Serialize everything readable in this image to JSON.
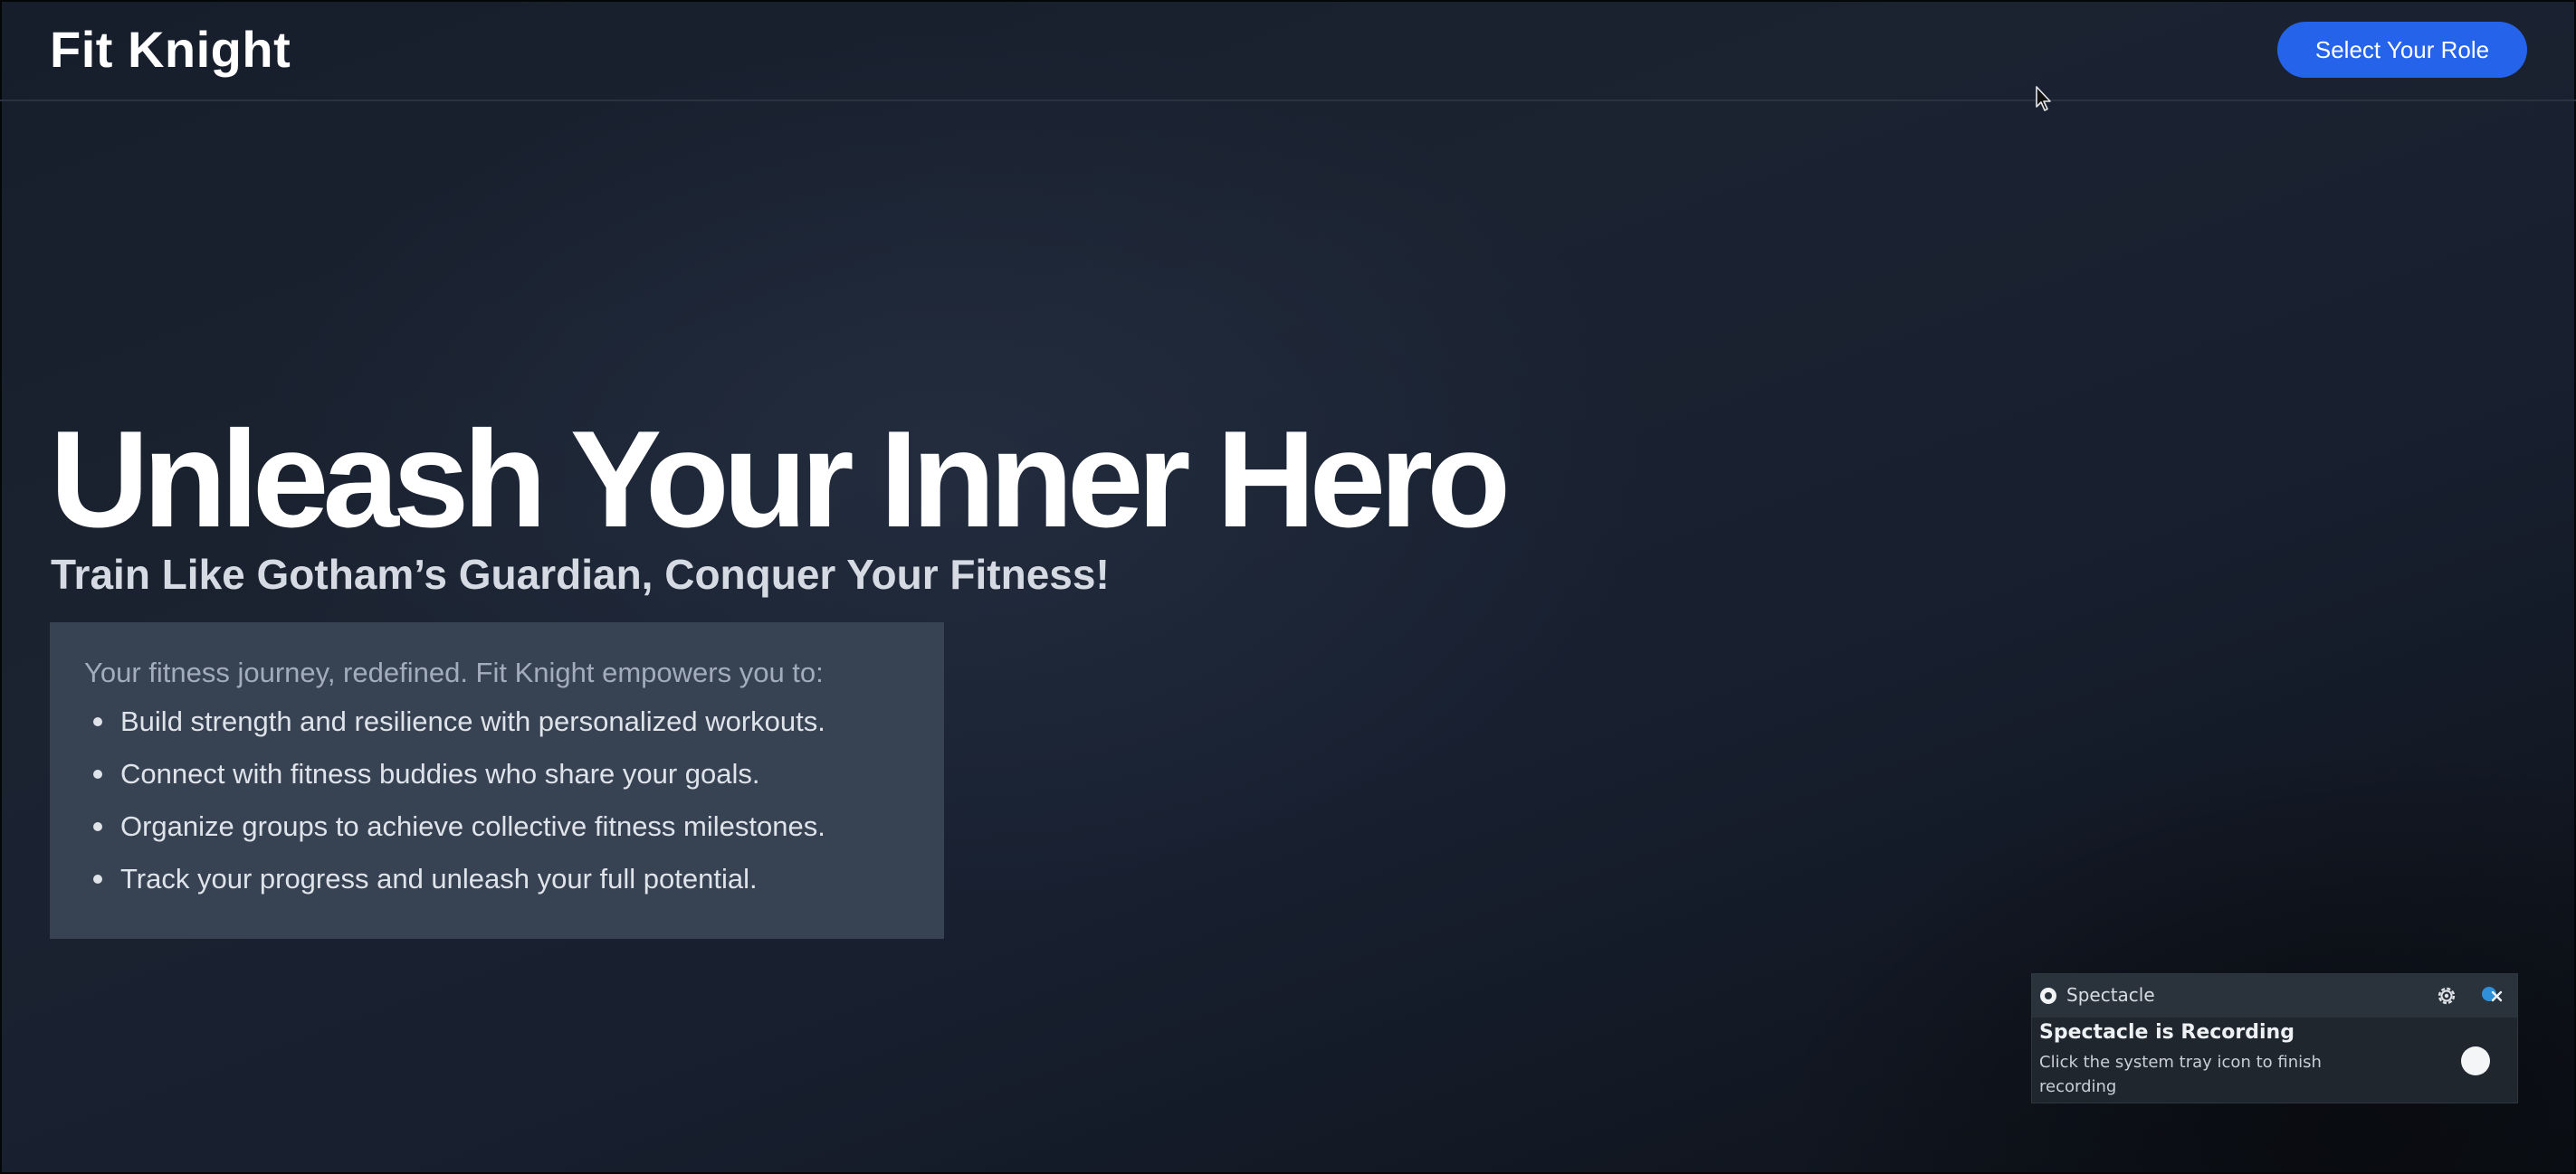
{
  "header": {
    "brand": "Fit Knight",
    "role_button_label": "Select Your Role"
  },
  "hero": {
    "title": "Unleash Your Inner Hero",
    "subtitle": "Train Like Gotham’s Guardian, Conquer Your Fitness!"
  },
  "info": {
    "intro": "Your fitness journey, redefined. Fit Knight empowers you to:",
    "items": [
      "Build strength and resilience with personalized workouts.",
      "Connect with fitness buddies who share your goals.",
      "Organize groups to achieve collective fitness milestones.",
      "Track your progress and unleash your full potential."
    ]
  },
  "notification": {
    "app_name": "Spectacle",
    "title": "Spectacle is Recording",
    "body": "Click the system tray icon to finish recording",
    "icons": [
      "spectacle-app-icon",
      "gear-icon",
      "close-icon"
    ]
  },
  "colors": {
    "accent": "#2563eb",
    "info_box_bg": "#374253",
    "page_bg": "#1b2331"
  }
}
